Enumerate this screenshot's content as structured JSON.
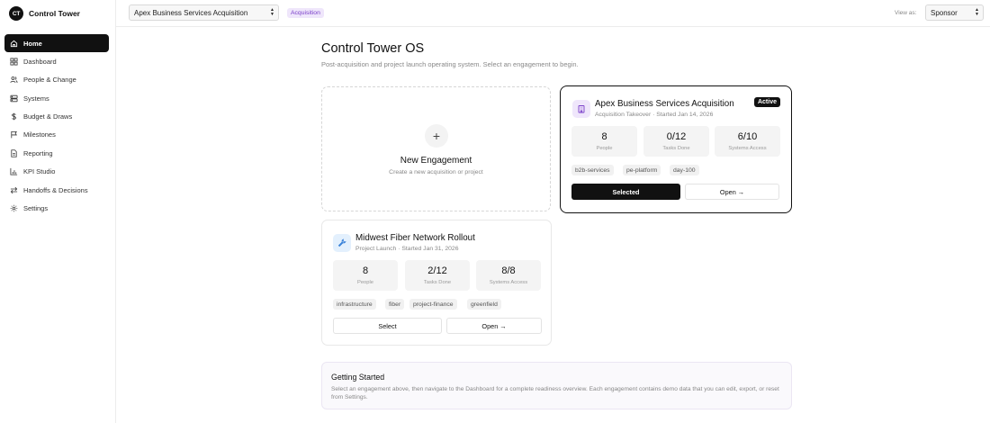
{
  "app": {
    "logo": "CT",
    "name": "Control Tower"
  },
  "nav": [
    {
      "label": "Home",
      "icon": "home-icon",
      "active": true
    },
    {
      "label": "Dashboard",
      "icon": "dashboard-icon"
    },
    {
      "label": "People & Change",
      "icon": "people-icon"
    },
    {
      "label": "Systems",
      "icon": "server-icon"
    },
    {
      "label": "Budget & Draws",
      "icon": "dollar-icon"
    },
    {
      "label": "Milestones",
      "icon": "flag-icon"
    },
    {
      "label": "Reporting",
      "icon": "document-icon"
    },
    {
      "label": "KPI Studio",
      "icon": "bar-chart-icon"
    },
    {
      "label": "Handoffs & Decisions",
      "icon": "swap-icon"
    },
    {
      "label": "Settings",
      "icon": "gear-icon"
    }
  ],
  "topbar": {
    "engagement_select": "Apex Business Services Acquisition",
    "engagement_tag": "Acquisition",
    "view_as_label": "View as:",
    "role_select": "Sponsor"
  },
  "main": {
    "title": "Control Tower OS",
    "subtitle": "Post-acquisition and project launch operating system. Select an engagement to begin."
  },
  "new_engagement": {
    "title": "New Engagement",
    "subtitle": "Create a new acquisition or project"
  },
  "engagements": [
    {
      "name": "Apex Business Services Acquisition",
      "meta": "Acquisition Takeover · Started Jan 14, 2026",
      "badge": "Active",
      "stats": [
        {
          "value": "8",
          "label": "People"
        },
        {
          "value": "0/12",
          "label": "Tasks Done"
        },
        {
          "value": "6/10",
          "label": "Systems Access"
        }
      ],
      "tags": [
        "b2b-services",
        "pe-platform",
        "day-100"
      ],
      "primary_button": "Selected",
      "secondary_button": "Open →"
    },
    {
      "name": "Midwest Fiber Network Rollout",
      "meta": "Project Launch · Started Jan 31, 2026",
      "stats": [
        {
          "value": "8",
          "label": "People"
        },
        {
          "value": "2/12",
          "label": "Tasks Done"
        },
        {
          "value": "8/8",
          "label": "Systems Access"
        }
      ],
      "tags": [
        "infrastructure",
        "fiber",
        "project-finance",
        "greenfield"
      ],
      "primary_button": "Select",
      "secondary_button": "Open →"
    }
  ],
  "getting_started": {
    "title": "Getting Started",
    "text": "Select an engagement above, then navigate to the Dashboard for a complete readiness overview. Each engagement contains demo data that you can edit, export, or reset from Settings."
  }
}
